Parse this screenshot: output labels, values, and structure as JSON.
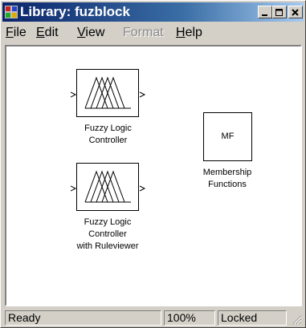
{
  "window": {
    "title": "Library: fuzblock"
  },
  "titlebar_buttons": [
    "minimize",
    "maximize",
    "close"
  ],
  "menu": [
    {
      "label": "File",
      "underline": "F",
      "rest": "ile",
      "enabled": true
    },
    {
      "label": "Edit",
      "underline": "E",
      "rest": "dit",
      "enabled": true
    },
    {
      "label": "View",
      "underline": "V",
      "rest": "iew",
      "enabled": true
    },
    {
      "label": "Format",
      "underline": "",
      "rest": "Format",
      "enabled": false
    },
    {
      "label": "Help",
      "underline": "H",
      "rest": "elp",
      "enabled": true
    }
  ],
  "blocks": {
    "flc": {
      "label_line1": "Fuzzy Logic",
      "label_line2": "Controller",
      "icon": "fuzzy-membership-icon"
    },
    "mf": {
      "text": "MF",
      "label_line1": "Membership",
      "label_line2": "Functions"
    },
    "flc_rv": {
      "label_line1": "Fuzzy Logic",
      "label_line2": "Controller",
      "label_line3": "with Ruleviewer",
      "icon": "fuzzy-membership-icon"
    }
  },
  "status": {
    "state": "Ready",
    "zoom": "100%",
    "lock": "Locked"
  }
}
